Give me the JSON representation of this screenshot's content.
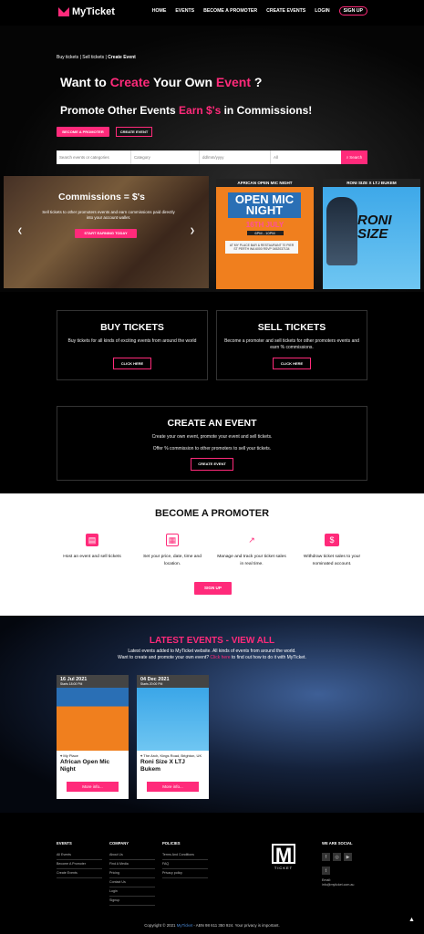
{
  "brand": {
    "name": "MyTicket",
    "accent": "#ff2a7a"
  },
  "nav": {
    "items": [
      "HOME",
      "EVENTS",
      "BECOME A PROMOTER",
      "CREATE EVENTS",
      "LOGIN"
    ],
    "signup": "SIGN UP"
  },
  "breadcrumb": {
    "a": "Buy tickets",
    "sep1": " | ",
    "b": "Sell tickets",
    "sep2": " | ",
    "current": "Create Event"
  },
  "hero": {
    "h1_a": "Want to ",
    "h1_b": "Create",
    "h1_c": " Your Own ",
    "h1_d": "Event",
    "h1_e": " ?",
    "h2_a": "Promote Other Events ",
    "h2_b": "Earn $'s",
    "h2_c": " in Commissions!",
    "btn_promoter": "BECOME A PROMOTER",
    "btn_create": "CREATE EVENT"
  },
  "search": {
    "placeholder": "Search events or categories",
    "category": "Category",
    "date": "dd/mm/yyyy",
    "all": "All",
    "button": "Search"
  },
  "slide": {
    "title": "Commissions = $'s",
    "text": "Sell tickets to other promoters events and earn commissions paid directly into your account wallet.",
    "button": "START EARNING TODAY"
  },
  "posters": [
    {
      "bar": "AFRICAN OPEN MIC NIGHT",
      "title": "OPEN MIC NIGHT",
      "date": "16TH JULY",
      "time": "6PM - 10PM",
      "addr": "AT MY PLACE BAR & RESTAURANT 70 PIER ST PERTH WA 6000 RSVP 0452037134"
    },
    {
      "bar": "RONI SIZE X LTJ BUKEM",
      "title": "RONI SIZE"
    }
  ],
  "buy": {
    "title": "BUY TICKETS",
    "text": "Buy tickets for all kinds of exciting events from around the world",
    "button": "CLICK HERE"
  },
  "sell": {
    "title": "SELL TICKETS",
    "text": "Become a promoter and sell tickets for other promoters events and earn % commissions.",
    "button": "CLICK HERE"
  },
  "create": {
    "title": "CREATE AN EVENT",
    "text1": "Create your own event, promote your event and sell tickets.",
    "text2": "Offer % commission to other promoters to sell your tickets.",
    "button": "CREATE EVENT"
  },
  "promoter": {
    "title": "BECOME A PROMOTER",
    "features": [
      "Host an event and sell tickets",
      "Set your price, date, time and location.",
      "Manage and track your ticket sales in real time.",
      "Withdraw ticket sales to your nominated account."
    ],
    "button": "SIGN UP"
  },
  "latest": {
    "title": "LATEST EVENTS - VIEW ALL",
    "line1": "Latest events added to MyTicket website. All kinds of events from around the world.",
    "line2a": "Want to create and promote your own event? ",
    "line2b": "Click here",
    "line2c": " to find out how to do it with MyTicket.",
    "events": [
      {
        "date": "16 Jul 2021",
        "starts": "Starts 18:00 PM",
        "venue": "My Place",
        "name": "African Open Mic Night",
        "more": "More info..."
      },
      {
        "date": "04 Dec 2021",
        "starts": "Starts 20:00 PM",
        "venue": "The Arch, Kings Road, Brighton, UK",
        "name": "Roni Size X LTJ Bukem",
        "more": "More info..."
      }
    ]
  },
  "footer": {
    "events": {
      "title": "EVENTS",
      "links": [
        "All Events",
        "Become A Promoter",
        "Create Events"
      ]
    },
    "company": {
      "title": "COMPANY",
      "links": [
        "About Us",
        "Find A Media",
        "Pricing",
        "Contact Us",
        "Login",
        "Signup"
      ]
    },
    "policies": {
      "title": "POLICIES",
      "links": [
        "Terms And Conditions",
        "FAQ",
        "Privacy policy"
      ]
    },
    "logo": "TICKET",
    "social": {
      "title": "WE ARE SOCIAL",
      "email_label": "Email:",
      "email": "info@myticket.com.au"
    },
    "copy_a": "Copyright © 2021 ",
    "copy_b": "MyTicket",
    "copy_c": " - ABN 98 611 350 924. Your privacy is important."
  }
}
